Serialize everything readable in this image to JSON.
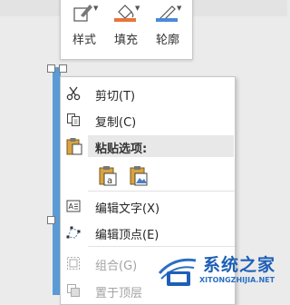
{
  "toolbar": {
    "style_label": "样式",
    "fill_label": "填充",
    "outline_label": "轮廓",
    "fill_color": "#e8743b",
    "outline_color": "#4a89dc"
  },
  "menu": {
    "cut": "剪切(T)",
    "copy": "复制(C)",
    "paste_options": "粘贴选项:",
    "edit_text": "编辑文字(X)",
    "edit_points": "编辑顶点(E)",
    "group": "组合(G)",
    "bring_to_front": "置于顶层"
  },
  "watermark": {
    "title": "系统之家",
    "url": "XITONGZHIJIA.NET"
  },
  "colors": {
    "shape_fill": "#5b9bd5",
    "menu_highlight": "#e8e8e8",
    "watermark_blue": "#1e5fb6"
  }
}
